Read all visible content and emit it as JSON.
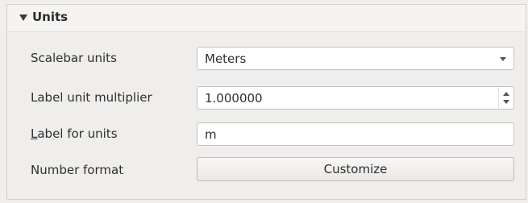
{
  "section": {
    "title": "Units"
  },
  "rows": {
    "scalebar_units": {
      "label": "Scalebar units",
      "value": "Meters"
    },
    "label_unit_multiplier": {
      "label": "Label unit multiplier",
      "value": "1.000000"
    },
    "label_for_units": {
      "label_rest": "abel for units",
      "label_underlined": "L",
      "value": "m"
    },
    "number_format": {
      "label": "Number format",
      "button": "Customize"
    }
  },
  "icons": {
    "collapse": "collapse-triangle-icon",
    "dropdown": "chevron-down-icon",
    "spin_up": "spin-up-icon",
    "spin_down": "spin-down-icon"
  }
}
